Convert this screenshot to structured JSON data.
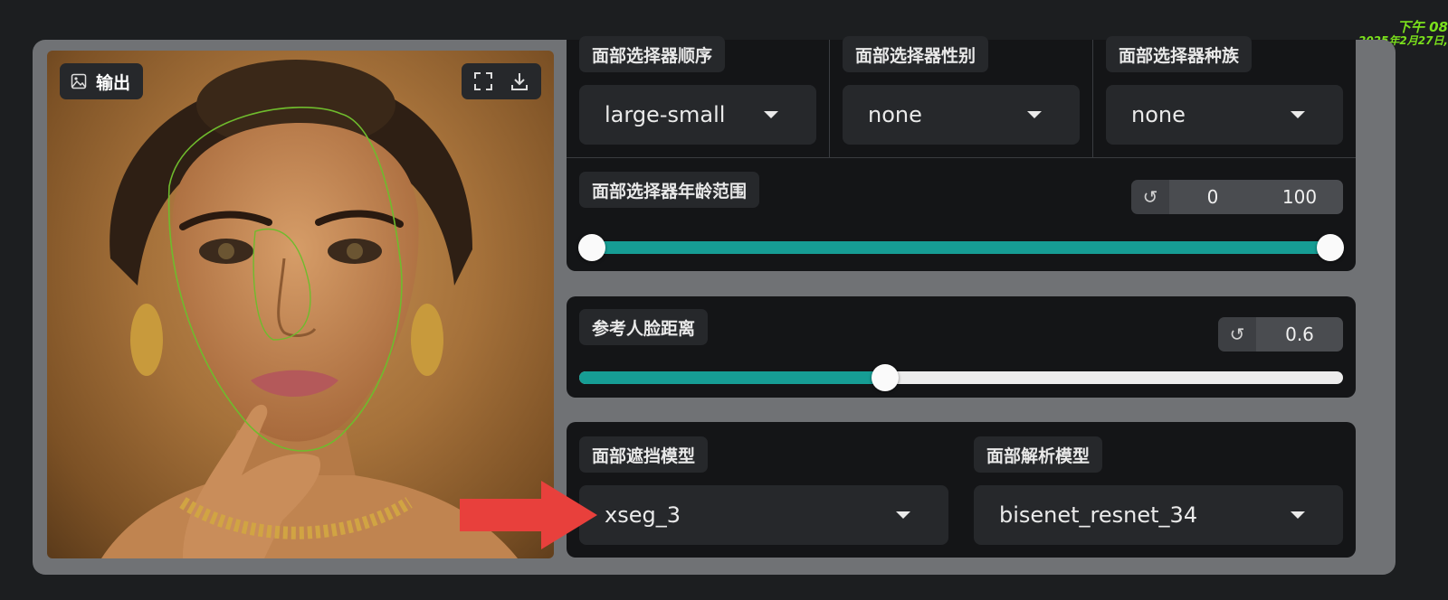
{
  "timestamp": {
    "time": "下午 08",
    "date": "2025年2月27日,"
  },
  "output_panel": {
    "label": "输出",
    "icons": [
      "image-icon",
      "fullscreen-icon",
      "download-icon"
    ]
  },
  "face_selector": {
    "order": {
      "label": "面部选择器顺序",
      "value": "large-small"
    },
    "gender": {
      "label": "面部选择器性别",
      "value": "none"
    },
    "race": {
      "label": "面部选择器种族",
      "value": "none"
    },
    "age_range": {
      "label": "面部选择器年龄范围",
      "min": "0",
      "max": "100",
      "range": [
        0,
        100
      ],
      "reset_icon": "reset-icon"
    }
  },
  "reference_distance": {
    "label": "参考人脸距离",
    "value": "0.6",
    "fraction": 0.4,
    "reset_icon": "reset-icon"
  },
  "models": {
    "occluder": {
      "label": "面部遮挡模型",
      "value": "xseg_3"
    },
    "parser": {
      "label": "面部解析模型",
      "value": "bisenet_resnet_34"
    }
  },
  "colors": {
    "accent": "#169d94",
    "arrow": "#e8403c",
    "timestamp": "#7be01c"
  }
}
